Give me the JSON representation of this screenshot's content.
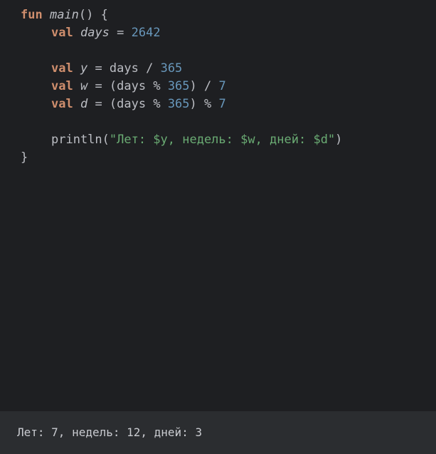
{
  "editor": {
    "line1": {
      "kw": "fun",
      "name": "main",
      "rest": "() {"
    },
    "line2": {
      "kw": "val",
      "name": "days",
      "op": " = ",
      "value": "2642"
    },
    "line4": {
      "kw": "val",
      "name": "y",
      "expr1": " = days / ",
      "num": "365"
    },
    "line5": {
      "kw": "val",
      "name": "w",
      "expr1": " = (days % ",
      "num1": "365",
      "expr2": ") / ",
      "num2": "7"
    },
    "line6": {
      "kw": "val",
      "name": "d",
      "expr1": " = (days % ",
      "num1": "365",
      "expr2": ") % ",
      "num2": "7"
    },
    "line8": {
      "call": "println(",
      "string": "\"Лет: $y, недель: $w, дней: $d\"",
      "close": ")"
    },
    "line9": {
      "brace": "}"
    }
  },
  "output": {
    "text": "Лет: 7, недель: 12, дней: 3"
  }
}
